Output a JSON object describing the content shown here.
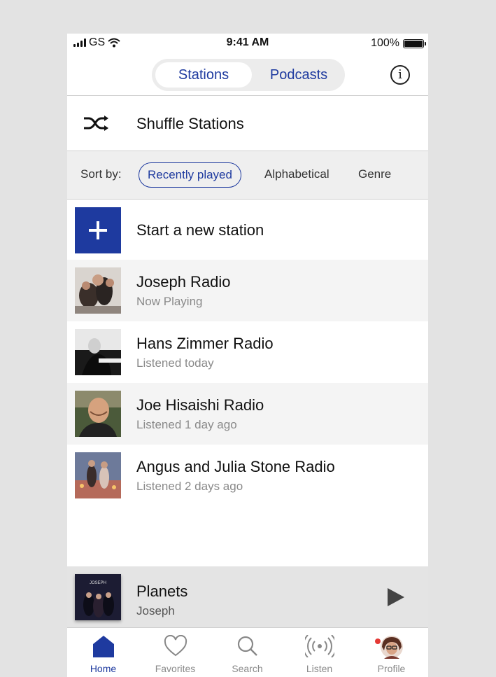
{
  "status_bar": {
    "carrier": "GS",
    "time": "9:41 AM",
    "battery": "100%"
  },
  "header": {
    "tabs": [
      {
        "label": "Stations",
        "active": true
      },
      {
        "label": "Podcasts",
        "active": false
      }
    ],
    "info_icon": "info-icon"
  },
  "shuffle": {
    "label": "Shuffle Stations",
    "icon": "shuffle-icon"
  },
  "sort": {
    "label": "Sort by:",
    "options": [
      "Recently played",
      "Alphabetical",
      "Genre"
    ],
    "selected": "Recently played"
  },
  "new_station": {
    "label": "Start a new station"
  },
  "stations": [
    {
      "title": "Joseph Radio",
      "subtitle": "Now Playing"
    },
    {
      "title": "Hans Zimmer Radio",
      "subtitle": "Listened today"
    },
    {
      "title": "Joe Hisaishi Radio",
      "subtitle": "Listened 1 day ago"
    },
    {
      "title": "Angus and Julia Stone Radio",
      "subtitle": "Listened 2 days ago"
    }
  ],
  "now_playing": {
    "title": "Planets",
    "artist": "Joseph",
    "cover_text": "JOSEPH"
  },
  "tabbar": {
    "items": [
      {
        "label": "Home",
        "icon": "home-icon",
        "active": true
      },
      {
        "label": "Favorites",
        "icon": "heart-icon",
        "active": false
      },
      {
        "label": "Search",
        "icon": "search-icon",
        "active": false
      },
      {
        "label": "Listen",
        "icon": "broadcast-icon",
        "active": false
      },
      {
        "label": "Profile",
        "icon": "avatar",
        "active": false
      }
    ]
  },
  "colors": {
    "accent": "#1e3a9f",
    "notification": "#e53935"
  }
}
